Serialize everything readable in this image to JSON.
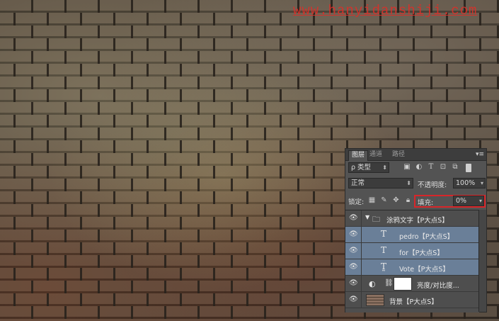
{
  "watermark": "www.hanyidanshiji.com",
  "panel": {
    "tabs": [
      "图层",
      "通道",
      "路径"
    ],
    "filter": {
      "kind_label": "ρ 类型"
    },
    "blend_mode": "正常",
    "opacity_label": "不透明度:",
    "opacity_value": "100%",
    "lock_label": "锁定:",
    "fill_label": "填充:",
    "fill_value": "0%",
    "layers": [
      {
        "name": "涂鸦文字【P大点S】",
        "type": "group"
      },
      {
        "name": "pedro【P大点S】",
        "type": "text"
      },
      {
        "name": "for【P大点S】",
        "type": "text"
      },
      {
        "name": "Vote【P大点S】",
        "type": "text-warp"
      },
      {
        "name": "亮度/对比度...",
        "type": "adjustment"
      },
      {
        "name": "背景【P大点S】",
        "type": "background"
      }
    ]
  },
  "colors": {
    "accent_highlight": "#d8262a",
    "selected_row": "#6a7f98"
  }
}
